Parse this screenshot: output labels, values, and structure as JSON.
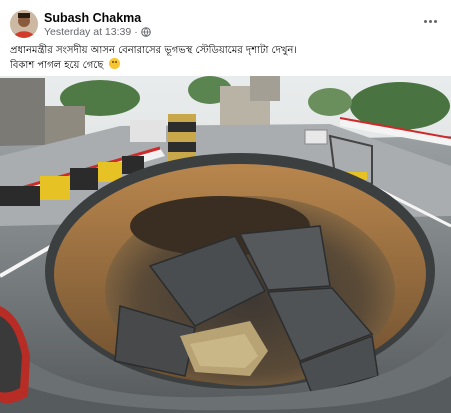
{
  "post": {
    "author": "Subash Chakma",
    "timestamp": "Yesterday at 13:39",
    "separator": "·",
    "privacy_icon": "globe-icon",
    "more_icon": "more-dots-icon",
    "text_line_1": "প্রধানমন্ত্রীর সংসদীয় আসন বেনারাসের ভূগভস্থ স্টেডিয়ামের দৃশাটা দেখুন।",
    "text_line_2": "বিকাশ পাগল হয়ে গেছে",
    "emoji": "smiling-face-emoji"
  },
  "photo": {
    "subject": "large-sinkhole-in-road-photo"
  },
  "colors": {
    "name_text": "#050505",
    "meta_text": "#65676b",
    "background": "#ffffff"
  }
}
